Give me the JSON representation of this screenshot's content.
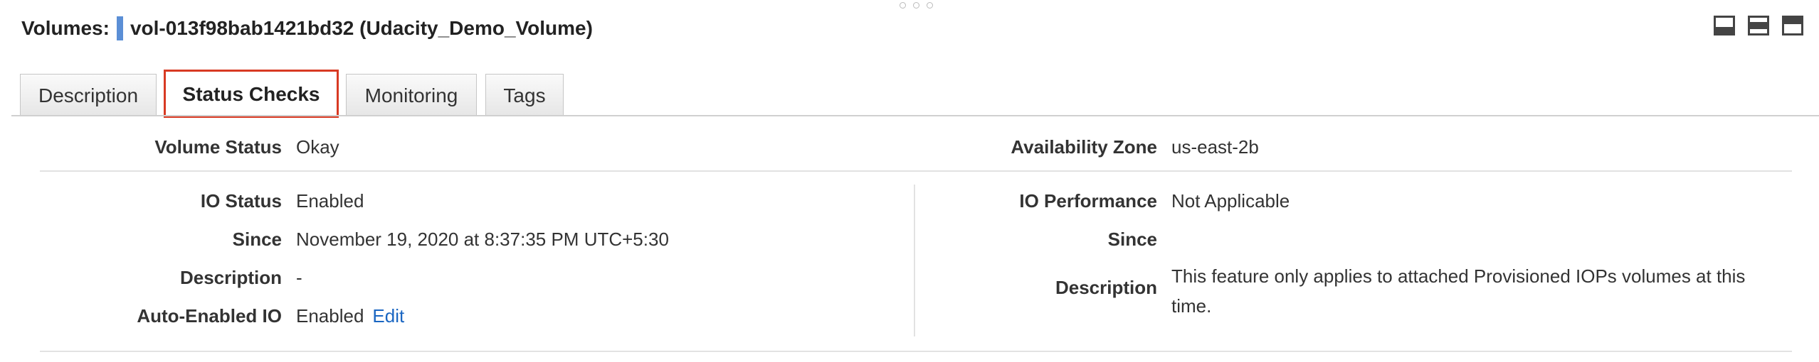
{
  "header": {
    "prefix": "Volumes:",
    "volume_title": "vol-013f98bab1421bd32 (Udacity_Demo_Volume)"
  },
  "icons": {
    "drag_handle": "drag-handle-icon",
    "layout_bottom": "panel-bottom-layout-icon",
    "layout_middle": "panel-middle-layout-icon",
    "layout_top": "panel-top-layout-icon"
  },
  "tabs": [
    {
      "label": "Description",
      "active": false
    },
    {
      "label": "Status Checks",
      "active": true
    },
    {
      "label": "Monitoring",
      "active": false
    },
    {
      "label": "Tags",
      "active": false
    }
  ],
  "status": {
    "volume_status_label": "Volume Status",
    "volume_status_value": "Okay",
    "availability_zone_label": "Availability Zone",
    "availability_zone_value": "us-east-2b",
    "io_status_label": "IO Status",
    "io_status_value": "Enabled",
    "since_label": "Since",
    "since_value": "November 19, 2020 at 8:37:35 PM UTC+5:30",
    "description_label": "Description",
    "description_value": "-",
    "auto_enabled_io_label": "Auto-Enabled IO",
    "auto_enabled_io_value": "Enabled",
    "edit_link": "Edit",
    "io_performance_label": "IO Performance",
    "io_performance_value": "Not Applicable",
    "right_since_label": "Since",
    "right_description_label": "Description",
    "right_description_value": "This feature only applies to attached Provisioned IOPs volumes at this time."
  },
  "colors": {
    "accent": "#5b8fd6",
    "link": "#1a66c2",
    "highlight": "#d83a23"
  }
}
